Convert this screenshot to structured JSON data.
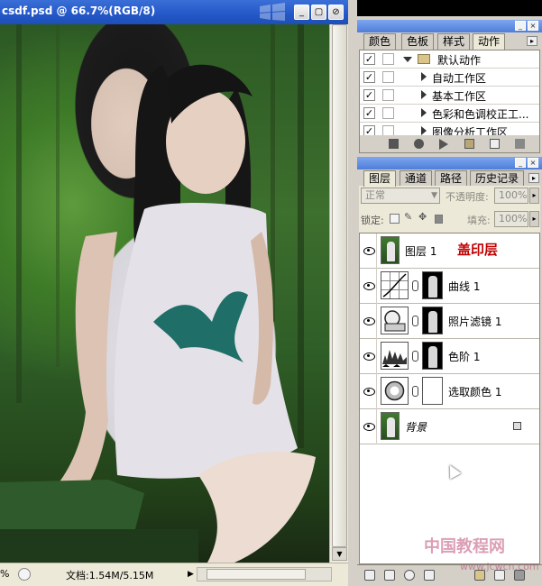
{
  "document": {
    "title": "csdf.psd @ 66.7%(RGB/8)",
    "status_zoom": "%",
    "status_doc": "文档:1.54M/5.15M"
  },
  "actions_panel": {
    "tabs": [
      "颜色",
      "色板",
      "样式",
      "动作"
    ],
    "active_tab": "动作",
    "items": [
      {
        "label": "默认动作",
        "checked": true,
        "type": "folder"
      },
      {
        "label": "自动工作区",
        "checked": true,
        "type": "action"
      },
      {
        "label": "基本工作区",
        "checked": true,
        "type": "action"
      },
      {
        "label": "色彩和色调校正工...",
        "checked": true,
        "type": "action"
      },
      {
        "label": "图像分析工作区",
        "checked": true,
        "type": "action"
      }
    ]
  },
  "layers_panel": {
    "tabs": [
      "图层",
      "通道",
      "路径",
      "历史记录"
    ],
    "active_tab": "图层",
    "blend_mode": "正常",
    "opacity_label": "不透明度:",
    "opacity_value": "100%",
    "lock_label": "锁定:",
    "fill_label": "填充:",
    "fill_value": "100%",
    "layers": [
      {
        "name": "图层 1",
        "kind": "image",
        "annotation": "盖印层"
      },
      {
        "name": "曲线 1",
        "kind": "adjustment-curves"
      },
      {
        "name": "照片滤镜 1",
        "kind": "adjustment-photo-filter"
      },
      {
        "name": "色阶 1",
        "kind": "adjustment-levels"
      },
      {
        "name": "选取颜色 1",
        "kind": "adjustment-selective-color"
      },
      {
        "name": "背景",
        "kind": "background",
        "locked": true
      }
    ]
  },
  "watermark": {
    "text": "中国教程网",
    "url": "www.jcwcn.com"
  },
  "colors": {
    "title_bar": "#2457c7",
    "panel_bg": "#d4d0c8",
    "annotation_red": "#c00000"
  }
}
